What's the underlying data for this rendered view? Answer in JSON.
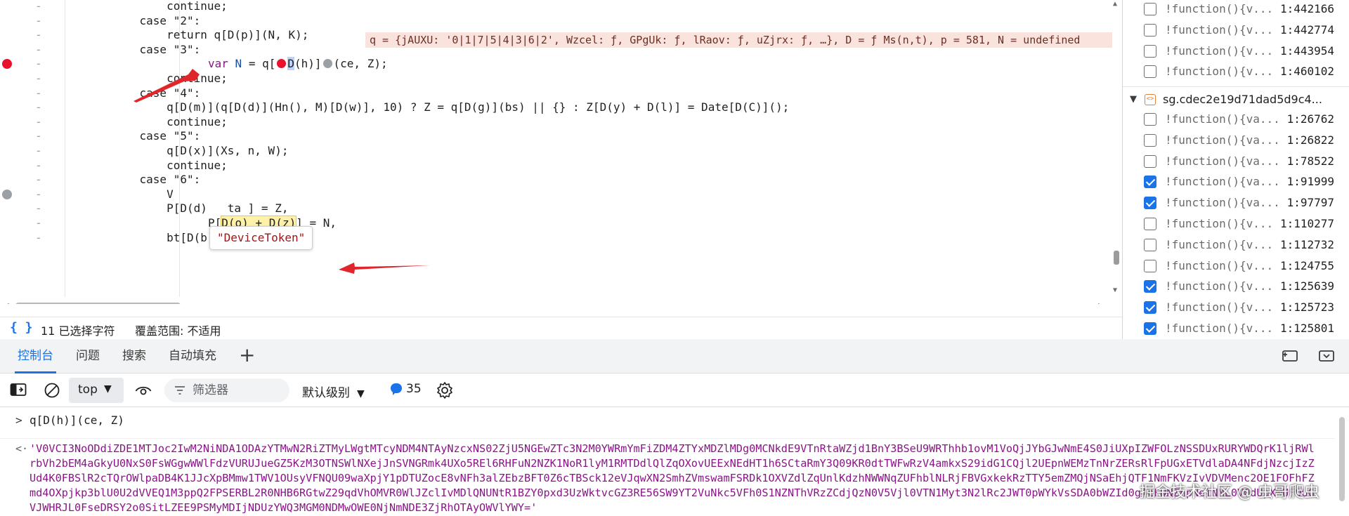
{
  "editor": {
    "lines": [
      {
        "num": "-",
        "code": "        continue;"
      },
      {
        "num": "-",
        "code": "    case \"2\":"
      },
      {
        "num": "-",
        "code": "        return q[D(p)](N, K);"
      },
      {
        "num": "-",
        "code": "    case \"3\":"
      },
      {
        "num": "-",
        "code": "var N = q[D(h)](ce, Z);"
      },
      {
        "num": "-",
        "code": "        continue;"
      },
      {
        "num": "-",
        "code": "    case \"4\":"
      },
      {
        "num": "-",
        "code": "        q[D(m)](q[D(d)](Hn(), M)[D(w)], 10) ? Z = q[D(g)](bs) || {} : Z[D(y) + D(l)] = Date[D(C)]();"
      },
      {
        "num": "-",
        "code": "        continue;"
      },
      {
        "num": "-",
        "code": "    case \"5\":"
      },
      {
        "num": "-",
        "code": "        q[D(x)](Xs, n, W);"
      },
      {
        "num": "-",
        "code": "        continue;"
      },
      {
        "num": "-",
        "code": "    case \"6\":"
      },
      {
        "num": "-",
        "code": "        V"
      },
      {
        "num": "-",
        "code": "        P[D(d)   ta ] = Z,"
      },
      {
        "num": "-",
        "code": "P[D(o) + D(z)] = N,"
      },
      {
        "num": "-",
        "code": "        bt[D(b)](P);"
      }
    ],
    "inline_value": "q = {jAUXU: '0|1|7|5|4|3|6|2', Wzcel: ƒ, GPgUk: ƒ, lRaov: ƒ, uZjrx: ƒ, …}, D = ƒ Ms(n,t), p = 581, N = undefined",
    "tooltip": "\"DeviceToken\"",
    "highlight_line_parts": {
      "kw": "var",
      "var": "N",
      "eq": " = q[",
      "sel": "D",
      "rest1": "(h)]",
      "rest2": "(ce, Z);"
    },
    "boxed_line_parts": {
      "pre": "P[",
      "box": "D(o) + D(z)",
      "post": "] = N,"
    }
  },
  "statusbar": {
    "braces": "{ }",
    "selected": "11 已选择字符",
    "coverage": "覆盖范围: 不适用"
  },
  "breakpoints_top": [
    {
      "fn": "!function(){v...",
      "loc": "1:442166",
      "checked": false
    },
    {
      "fn": "!function(){v...",
      "loc": "1:442774",
      "checked": false
    },
    {
      "fn": "!function(){v...",
      "loc": "1:443954",
      "checked": false
    },
    {
      "fn": "!function(){v...",
      "loc": "1:460102",
      "checked": false
    }
  ],
  "breakpoint_file": "sg.cdec2e19d71dad5d9c4...",
  "breakpoints_file": [
    {
      "fn": "!function(){va...",
      "loc": "1:26762",
      "checked": false
    },
    {
      "fn": "!function(){va...",
      "loc": "1:26822",
      "checked": false
    },
    {
      "fn": "!function(){va...",
      "loc": "1:78522",
      "checked": false
    },
    {
      "fn": "!function(){va...",
      "loc": "1:91999",
      "checked": true
    },
    {
      "fn": "!function(){va...",
      "loc": "1:97797",
      "checked": true
    },
    {
      "fn": "!function(){v...",
      "loc": "1:110277",
      "checked": false
    },
    {
      "fn": "!function(){v...",
      "loc": "1:112732",
      "checked": false
    },
    {
      "fn": "!function(){v...",
      "loc": "1:124755",
      "checked": false
    },
    {
      "fn": "!function(){v...",
      "loc": "1:125639",
      "checked": true
    },
    {
      "fn": "!function(){v...",
      "loc": "1:125723",
      "checked": true
    },
    {
      "fn": "!function(){v...",
      "loc": "1:125801",
      "checked": true
    }
  ],
  "drawer": {
    "tabs": [
      "控制台",
      "问题",
      "搜索",
      "自动填充"
    ],
    "add": "+"
  },
  "console_toolbar": {
    "context": "top",
    "filter_placeholder": "筛选器",
    "level": "默认级别",
    "issues_count": "35"
  },
  "console": {
    "prompt": ">",
    "input": "q[D(h)](ce, Z)",
    "back": "<·",
    "output": "'V0VCI3NoODdiZDE1MTJoc2IwM2NiNDA1ODAzYTMwN2RiZTMyLWgtMTcyNDM4NTAyNzcxNS02ZjU5NGEwZTc3N2M0YWRmYmFiZDM4ZTYxMDZlMDg0MCNkdE9VTnRtaWZjd1BnY3BSeU9WRThhb1ovM1VoQjJYbGJwNmE4S0JiUXpIZWFOLzNSSDUxRURYWDQrK1ljRWlrbVh2bEM4aGkyU0NxS0FsWGgwWWlFdzVURUJueGZ5KzM3OTNSWlNXejJnSVNGRmk4UXo5REl6RHFuN2NZK1NoR1lyM1RMTDdlQlZqOXovUEExNEdHT1h6SCtaRmY3Q09KR0dtTWFwRzV4amkxS29idG1CQjl2UEpnWEMzTnNrZERsRlFpUGxETVdlaDA4NFdjNzcjIzZUd4K0FBSlR2cTQrOWlpaDB4K1JJcXpBMmw1TWV1OUsyVFNQU09waXpjY1pDTUZocE8vNFh3alZEbzBFT0Z6cTBSck12eVJqwXN2SmhZVmswamFSRDk1OXVZdlZqUnlKdzhNWWNqZUFhblNLRjFBVGxkekRzTTY5emZMQjNSaEhjQTF1NmFKVzIvVDVMenc2OE1FOFhFZmd4OXpjkp3blU0U2dVVEQ1M3ppQ2FPSERBL2R0NHB6RGtwZ29qdVhOMVR0WlJZclIvMDlQNUNtR1BZY0pxd3UzWktvcGZ3RE56SW9YT2VuNkc5VFh0S1NZNThVRzZCdjQzN0V5Vjl0VTN1Myt3N2lRc2JWT0pWYkVsSDA0bWZId0g4cFNNZnpNeTNML0V0dUpXMUFQUGVJWHRJL0FseDRSY2o0SitLZEE9PSMyMDIjNDUzYWQ3MGM0NDMwOWE0NjNmNDE3ZjRhOTAyOWVlYWY='"
  },
  "watermark": "掘金技术社区 @ 虫哥爬虫",
  "colors": {
    "accent": "#1a73e8",
    "breakpoint": "#e8122d",
    "highlight_line": "#fff7a8",
    "inline_value_bg": "#fbe3dd",
    "string": "#8a1587"
  }
}
